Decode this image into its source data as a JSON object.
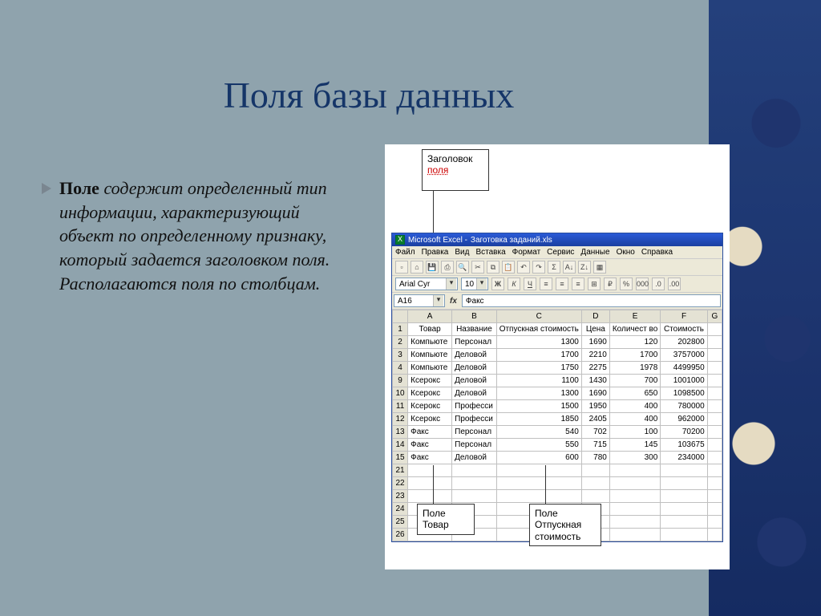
{
  "title": "Поля базы данных",
  "body": {
    "lead": "Поле",
    "rest": " содержит определенный тип информации, характеризующий объект по определенному признаку, который задается заголовком поля. Располагаются поля  по столбцам."
  },
  "callouts": {
    "header": {
      "l1": "Заголовок",
      "l2": "поля"
    },
    "field1": {
      "l1": "Поле",
      "l2": "Товар"
    },
    "field2": {
      "l1": "Поле",
      "l2": "Отпускная",
      "l3": "стоимость"
    }
  },
  "excel": {
    "title_prefix": "Microsoft Excel - ",
    "title_doc": "Заготовка заданий.xls",
    "menu": [
      "Файл",
      "Правка",
      "Вид",
      "Вставка",
      "Формат",
      "Сервис",
      "Данные",
      "Окно",
      "Справка"
    ],
    "font_name": "Arial Cyr",
    "font_size": "10",
    "percent_btn": "%",
    "thousand_btn": "000",
    "name_box": "A16",
    "fx_label": "fx",
    "formula_bar": "Факс",
    "col_letters": [
      "A",
      "B",
      "C",
      "D",
      "E",
      "F",
      "G"
    ],
    "headers": [
      "Товар",
      "Название",
      "Отпускная стоимость",
      "Цена",
      "Количест во",
      "Стоимость"
    ],
    "rows": [
      {
        "n": "2",
        "c": [
          "Компьюте",
          "Персонал",
          "1300",
          "1690",
          "120",
          "202800"
        ]
      },
      {
        "n": "3",
        "c": [
          "Компьюте",
          "Деловой",
          "1700",
          "2210",
          "1700",
          "3757000"
        ]
      },
      {
        "n": "4",
        "c": [
          "Компьюте",
          "Деловой",
          "1750",
          "2275",
          "1978",
          "4499950"
        ]
      },
      {
        "n": "9",
        "c": [
          "Ксерокс",
          "Деловой",
          "1100",
          "1430",
          "700",
          "1001000"
        ]
      },
      {
        "n": "10",
        "c": [
          "Ксерокс",
          "Деловой",
          "1300",
          "1690",
          "650",
          "1098500"
        ]
      },
      {
        "n": "11",
        "c": [
          "Ксерокс",
          "Професси",
          "1500",
          "1950",
          "400",
          "780000"
        ]
      },
      {
        "n": "12",
        "c": [
          "Ксерокс",
          "Професси",
          "1850",
          "2405",
          "400",
          "962000"
        ]
      },
      {
        "n": "13",
        "c": [
          "Факс",
          "Персонал",
          "540",
          "702",
          "100",
          "70200"
        ]
      },
      {
        "n": "14",
        "c": [
          "Факс",
          "Персонал",
          "550",
          "715",
          "145",
          "103675"
        ]
      },
      {
        "n": "15",
        "c": [
          "Факс",
          "Деловой",
          "600",
          "780",
          "300",
          "234000"
        ]
      }
    ],
    "empty_rows": [
      "21",
      "22",
      "23",
      "24",
      "25",
      "26"
    ]
  },
  "chart_data": {
    "type": "table",
    "title": "Поля базы данных — пример таблицы Excel",
    "columns": [
      "Товар",
      "Название",
      "Отпускная стоимость",
      "Цена",
      "Количество",
      "Стоимость"
    ],
    "records": [
      [
        "Компьютер",
        "Персональный",
        1300,
        1690,
        120,
        202800
      ],
      [
        "Компьютер",
        "Деловой",
        1700,
        2210,
        1700,
        3757000
      ],
      [
        "Компьютер",
        "Деловой",
        1750,
        2275,
        1978,
        4499950
      ],
      [
        "Ксерокс",
        "Деловой",
        1100,
        1430,
        700,
        1001000
      ],
      [
        "Ксерокс",
        "Деловой",
        1300,
        1690,
        650,
        1098500
      ],
      [
        "Ксерокс",
        "Профессиональный",
        1500,
        1950,
        400,
        780000
      ],
      [
        "Ксерокс",
        "Профессиональный",
        1850,
        2405,
        400,
        962000
      ],
      [
        "Факс",
        "Персональный",
        540,
        702,
        100,
        70200
      ],
      [
        "Факс",
        "Персональный",
        550,
        715,
        145,
        103675
      ],
      [
        "Факс",
        "Деловой",
        600,
        780,
        300,
        234000
      ]
    ]
  }
}
